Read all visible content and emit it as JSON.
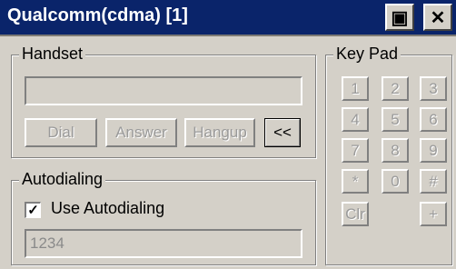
{
  "window": {
    "title": "Qualcomm(cdma) [1]",
    "buttons": [
      {
        "name": "restore-icon",
        "glyph": "▣"
      },
      {
        "name": "close-icon",
        "glyph": "✕"
      }
    ]
  },
  "handset": {
    "label": "Handset",
    "number_field": "",
    "buttons": {
      "dial": "Dial",
      "answer": "Answer",
      "hangup": "Hangup",
      "collapse": "<<"
    }
  },
  "autodialing": {
    "label": "Autodialing",
    "checkbox_label": "Use Autodialing",
    "checked": true,
    "check_glyph": "✓",
    "number": "1234"
  },
  "keypad": {
    "label": "Key Pad",
    "keys": [
      "1",
      "2",
      "3",
      "4",
      "5",
      "6",
      "7",
      "8",
      "9",
      "*",
      "0",
      "#",
      "Clr",
      "+"
    ]
  }
}
